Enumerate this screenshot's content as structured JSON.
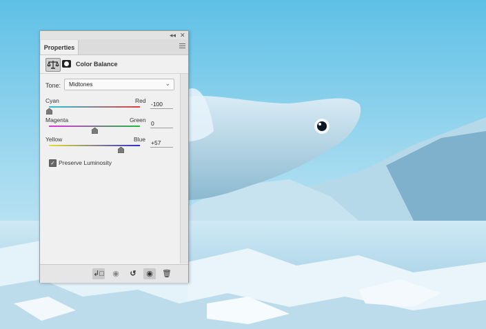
{
  "panel": {
    "tab_label": "Properties",
    "collapse_glyph": "◂◂",
    "close_glyph": "✕",
    "adjustment_title": "Color Balance",
    "tone": {
      "label": "Tone:",
      "value": "Midtones",
      "chevron": "⌄"
    },
    "sliders": [
      {
        "left_label": "Cyan",
        "right_label": "Red",
        "value": "-100",
        "level": -100,
        "track_from": "#24c3da",
        "track_to": "#e03b3b"
      },
      {
        "left_label": "Magenta",
        "right_label": "Green",
        "value": "0",
        "level": 0,
        "track_from": "#e12ee1",
        "track_to": "#1eb83c"
      },
      {
        "left_label": "Yellow",
        "right_label": "Blue",
        "value": "+57",
        "level": 57,
        "track_from": "#e6e02a",
        "track_to": "#2c2cd6"
      }
    ],
    "preserve_luminosity": {
      "label": "Preserve Luminosity",
      "checked": true,
      "mark": "✓"
    },
    "bottom_buttons": {
      "clip_glyph": "↲□",
      "view_prev_glyph": "◉",
      "reset_glyph": "↺",
      "visibility_glyph": "◉",
      "delete_glyph": "🗑"
    }
  },
  "icons": [
    "scales-icon",
    "mask-icon",
    "panel-menu-icon",
    "chevron-down-icon",
    "checkbox-icon",
    "clip-to-layer-icon",
    "view-previous-icon",
    "reset-icon",
    "eye-icon",
    "trash-icon"
  ]
}
